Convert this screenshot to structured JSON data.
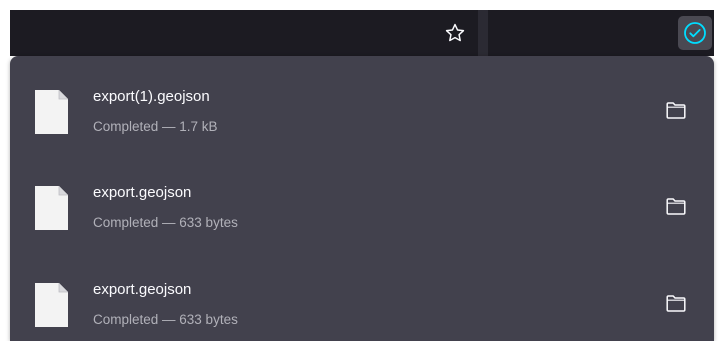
{
  "toolbar": {
    "bookmark_icon": "star-outline-icon",
    "downloads_icon": "check-circle-icon",
    "accent_color": "#00ddff"
  },
  "downloads": {
    "items": [
      {
        "filename": "export(1).geojson",
        "status": "Completed — 1.7 kB",
        "file_icon": "document-icon",
        "action_icon": "folder-icon"
      },
      {
        "filename": "export.geojson",
        "status": "Completed — 633 bytes",
        "file_icon": "document-icon",
        "action_icon": "folder-icon"
      },
      {
        "filename": "export.geojson",
        "status": "Completed — 633 bytes",
        "file_icon": "document-icon",
        "action_icon": "folder-icon"
      }
    ]
  }
}
